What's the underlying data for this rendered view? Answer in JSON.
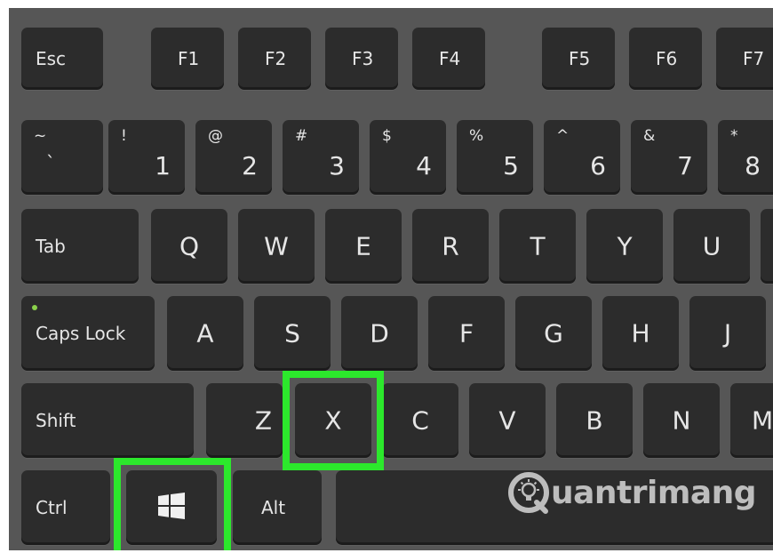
{
  "keyboard": {
    "function_row": {
      "esc": "Esc",
      "f1": "F1",
      "f2": "F2",
      "f3": "F3",
      "f4": "F4",
      "f5": "F5",
      "f6": "F6",
      "f7": "F7"
    },
    "number_row": [
      {
        "top": "~",
        "main": "`"
      },
      {
        "top": "!",
        "main": "1"
      },
      {
        "top": "@",
        "main": "2"
      },
      {
        "top": "#",
        "main": "3"
      },
      {
        "top": "$",
        "main": "4"
      },
      {
        "top": "%",
        "main": "5"
      },
      {
        "top": "^",
        "main": "6"
      },
      {
        "top": "&",
        "main": "7"
      },
      {
        "top": "*",
        "main": "8"
      }
    ],
    "qwerty_row": {
      "tab": "Tab",
      "keys": [
        "Q",
        "W",
        "E",
        "R",
        "T",
        "Y",
        "U"
      ]
    },
    "home_row": {
      "caps": "Caps Lock",
      "keys": [
        "A",
        "S",
        "D",
        "F",
        "G",
        "H",
        "J"
      ]
    },
    "shift_row": {
      "shift": "Shift",
      "keys": [
        "Z",
        "X",
        "C",
        "V",
        "B",
        "N",
        "M"
      ]
    },
    "bottom_row": {
      "ctrl": "Ctrl",
      "alt": "Alt"
    },
    "highlighted_keys": [
      "X",
      "windows-key"
    ],
    "highlight_color": "#2ce82c"
  },
  "watermark": {
    "text": "uantrimang",
    "logo_letter": "Q"
  }
}
